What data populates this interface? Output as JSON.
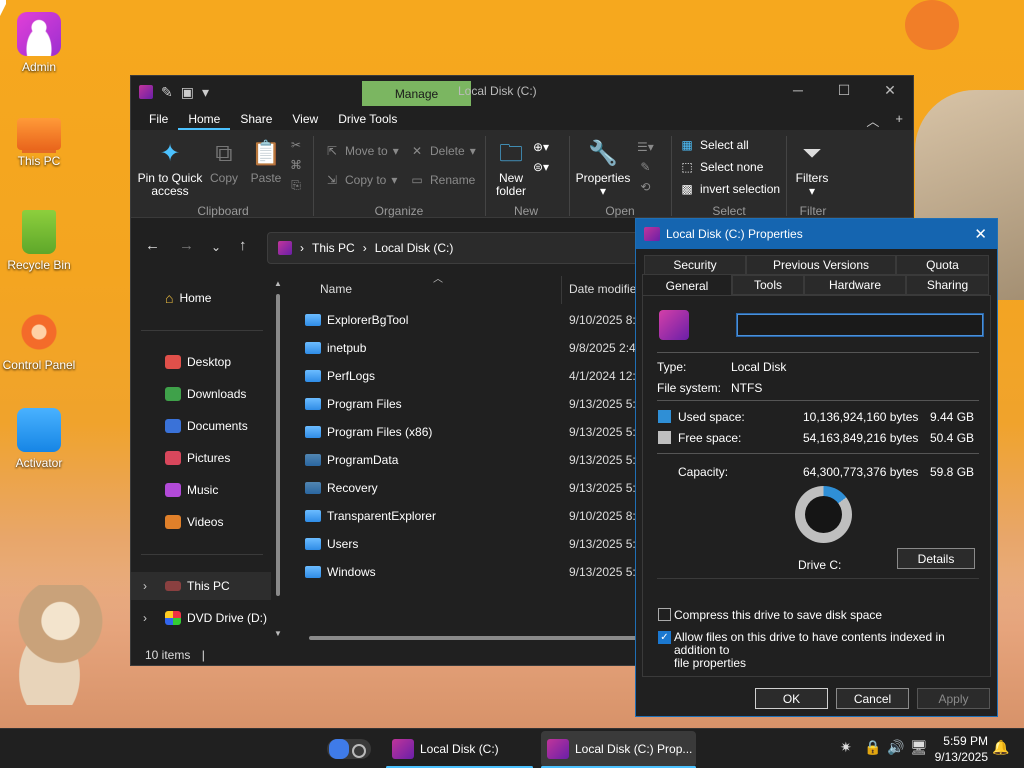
{
  "desktop": {
    "icons": [
      {
        "label": "Admin",
        "icon": "admin-user-icon"
      },
      {
        "label": "This PC",
        "icon": "this-pc-icon"
      },
      {
        "label": "Recycle Bin",
        "icon": "recycle-bin-icon"
      },
      {
        "label": "Control Panel",
        "icon": "control-panel-icon"
      },
      {
        "label": "Activator",
        "icon": "activator-icon"
      }
    ]
  },
  "explorer": {
    "context_tab": "Manage",
    "title": "Local Disk (C:)",
    "menu": [
      "File",
      "Home",
      "Share",
      "View",
      "Drive Tools"
    ],
    "active_menu": "Home",
    "ribbon": {
      "pin": "Pin to Quick access",
      "pin_line1": "Pin to Quick",
      "pin_line2": "access",
      "copy": "Copy",
      "paste": "Paste",
      "move_to": "Move to",
      "copy_to": "Copy to",
      "delete": "Delete",
      "rename": "Rename",
      "new_folder_line1": "New",
      "new_folder_line2": "folder",
      "properties": "Properties",
      "select_all": "Select all",
      "select_none": "Select none",
      "invert_selection": "invert selection",
      "filters": "Filters",
      "groups": [
        "Clipboard",
        "Organize",
        "New",
        "Open",
        "Select",
        "Filter"
      ]
    },
    "breadcrumb": [
      "This PC",
      "Local Disk (C:)"
    ],
    "sidebar": [
      {
        "label": "Home",
        "icon": "home-icon"
      },
      {
        "label": "Desktop",
        "icon": "desktop-folder-icon"
      },
      {
        "label": "Downloads",
        "icon": "downloads-folder-icon"
      },
      {
        "label": "Documents",
        "icon": "documents-folder-icon"
      },
      {
        "label": "Pictures",
        "icon": "pictures-folder-icon"
      },
      {
        "label": "Music",
        "icon": "music-folder-icon"
      },
      {
        "label": "Videos",
        "icon": "videos-folder-icon"
      },
      {
        "label": "This PC",
        "icon": "this-pc-icon"
      },
      {
        "label": "DVD Drive (D:)",
        "icon": "dvd-drive-icon"
      }
    ],
    "columns": {
      "name": "Name",
      "date": "Date modifie"
    },
    "files": [
      {
        "name": "ExplorerBgTool",
        "date": "9/10/2025 8:2"
      },
      {
        "name": "inetpub",
        "date": "9/8/2025 2:46"
      },
      {
        "name": "PerfLogs",
        "date": "4/1/2024 12:2"
      },
      {
        "name": "Program Files",
        "date": "9/13/2025 5:5"
      },
      {
        "name": "Program Files (x86)",
        "date": "9/13/2025 5:4"
      },
      {
        "name": "ProgramData",
        "date": "9/13/2025 5:4"
      },
      {
        "name": "Recovery",
        "date": "9/13/2025 5:4"
      },
      {
        "name": "TransparentExplorer",
        "date": "9/10/2025 8:2"
      },
      {
        "name": "Users",
        "date": "9/13/2025 5:4"
      },
      {
        "name": "Windows",
        "date": "9/13/2025 5:4"
      }
    ],
    "status": "10 items"
  },
  "properties": {
    "title": "Local Disk (C:) Properties",
    "tabs_row1": [
      "Security",
      "Previous Versions",
      "Quota"
    ],
    "tabs_row2": [
      "General",
      "Tools",
      "Hardware",
      "Sharing"
    ],
    "active_tab": "General",
    "name_value": "",
    "type_label": "Type:",
    "type_value": "Local Disk",
    "fs_label": "File system:",
    "fs_value": "NTFS",
    "used_label": "Used space:",
    "used_bytes": "10,136,924,160 bytes",
    "used_gb": "9.44 GB",
    "free_label": "Free space:",
    "free_bytes": "54,163,849,216 bytes",
    "free_gb": "50.4 GB",
    "cap_label": "Capacity:",
    "cap_bytes": "64,300,773,376 bytes",
    "cap_gb": "59.8 GB",
    "used_fraction": 0.147,
    "drive_label": "Drive C:",
    "details": "Details",
    "compress": "Compress this drive to save disk space",
    "compress_checked": false,
    "index_line1": "Allow files on this drive to have contents indexed in addition to",
    "index_line2": "file properties",
    "index_checked": true,
    "ok": "OK",
    "cancel": "Cancel",
    "apply": "Apply",
    "colors": {
      "used": "#2f8fd6",
      "free": "#bfbfbf",
      "title": "#1565b0"
    }
  },
  "taskbar": {
    "apps": [
      {
        "label": "Local Disk (C:)"
      },
      {
        "label": "Local Disk (C:) Prop..."
      }
    ],
    "time": "5:59 PM",
    "date": "9/13/2025"
  }
}
